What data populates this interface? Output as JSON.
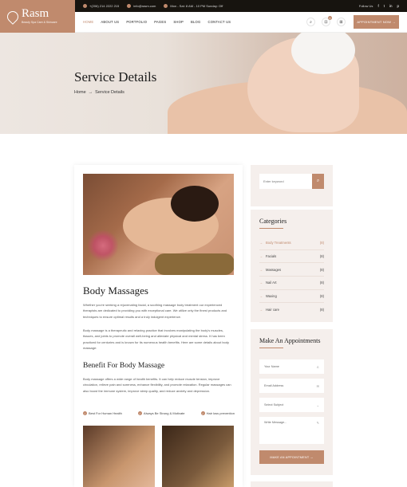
{
  "brand": {
    "name": "Rasm",
    "tagline": "Beauty Spa Care & Skincare"
  },
  "topbar": {
    "phone": "+(206) 214 2222 215",
    "email": "info@rasm.com",
    "hours": "Mon - Sat: 8 AM - 10 PM Sunday: Off",
    "follow_label": "Follow Us",
    "socials": [
      "f",
      "t",
      "in",
      "p"
    ]
  },
  "nav": {
    "items": [
      "HOME",
      "ABOUT US",
      "PORTFOLIO",
      "PAGES",
      "SHOP",
      "BLOG",
      "CONTACT US"
    ],
    "active_index": 0,
    "cart_count": "0",
    "appointment_button": "APPOINTMENT NOW"
  },
  "hero": {
    "title": "Service Details",
    "breadcrumb_home": "Home",
    "breadcrumb_sep": "→",
    "breadcrumb_current": "Service Details"
  },
  "article": {
    "title": "Body Massages",
    "para1": "Whether you're seeking a rejuvenating facial, a soothing massage body treatment our experienced therapists are dedicated to providing you with exceptional care. We utilize only the finest products and techniques to ensure optimal results and a truly indulgent experience.",
    "para2": "Body massage is a therapeutic and relaxing practice that involves manipulating the body's muscles, tissues, and joints to promote overall well-being and alleviate physical and mental stress. It has been practiced for centuries and is known for its numerous health benefits. Here are some details about body massage:",
    "benefit_title": "Benefit For Body Massage",
    "benefit_text": "Body massage offers a wide range of health benefits. It can help reduce muscle tension, improve circulation, relieve pain and soreness, enhance flexibility, and promote relaxation. Regular massages can also boost the immune system, improve sleep quality, and reduce anxiety and depression.",
    "features": [
      "Best For Human Health",
      "Always Be Strong & Motivate",
      "Hair loss prevention"
    ]
  },
  "sidebar": {
    "search_placeholder": "Enter keyword",
    "categories_title": "Categories",
    "categories": [
      {
        "name": "Body Treatments",
        "count": "(8)"
      },
      {
        "name": "Facials",
        "count": "(8)"
      },
      {
        "name": "Massages",
        "count": "(8)"
      },
      {
        "name": "Nail Art",
        "count": "(8)"
      },
      {
        "name": "Waxing",
        "count": "(8)"
      },
      {
        "name": "Hair care",
        "count": "(8)"
      }
    ],
    "active_category": 0,
    "appointment_title": "Make An Appointments",
    "form": {
      "name_placeholder": "Your Name",
      "email_placeholder": "Email Address",
      "subject_placeholder": "Select Subject",
      "message_placeholder": "Write Message...",
      "submit_label": "MAKE AN APPOINTMENT"
    }
  },
  "colors": {
    "accent": "#c08a6d",
    "dark": "#17140f",
    "panel": "#f5efec"
  }
}
